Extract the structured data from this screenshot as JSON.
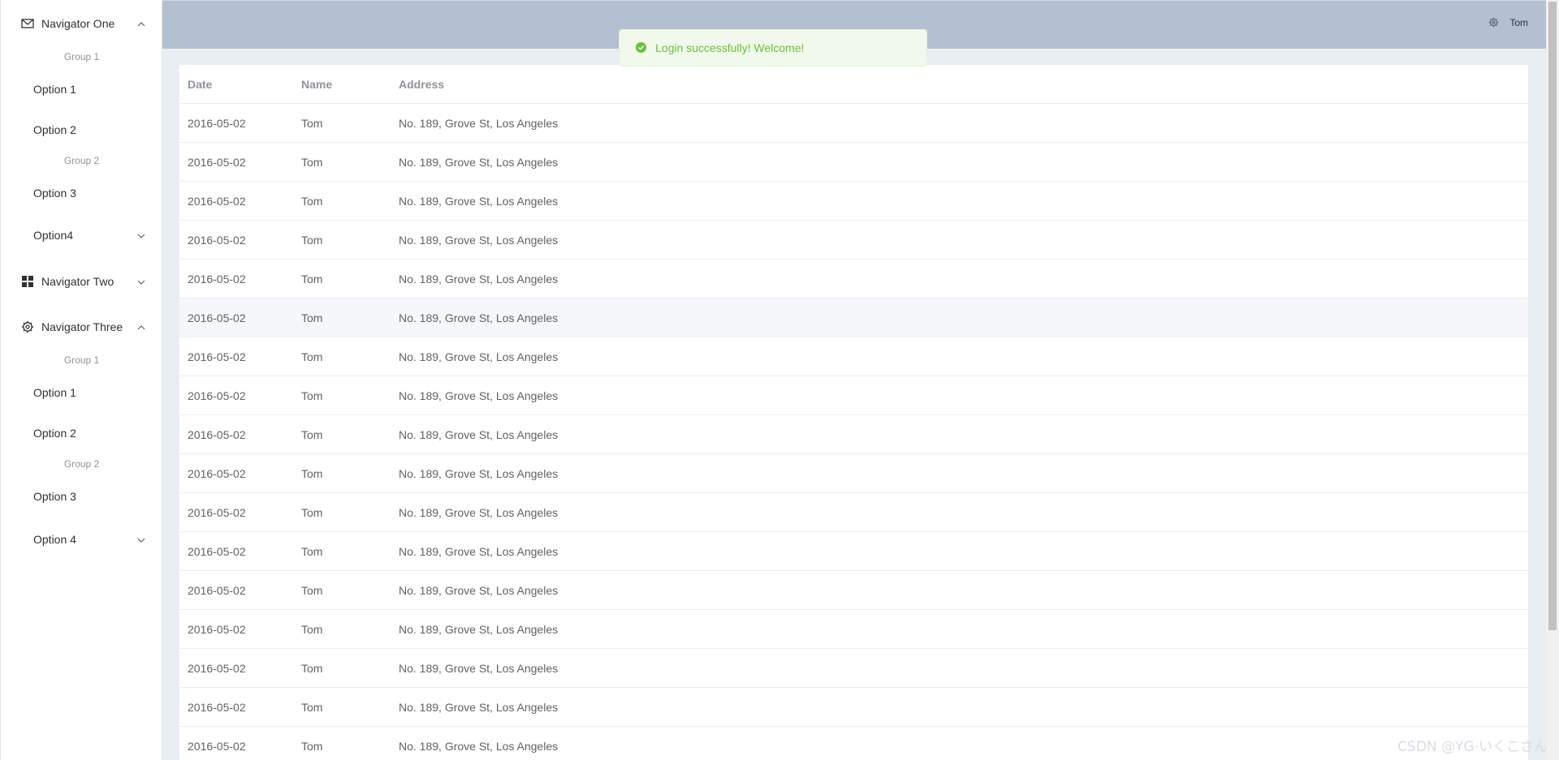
{
  "sidebar": {
    "nav1": {
      "label": "Navigator One",
      "icon": "mail-icon",
      "group1": "Group 1",
      "options1": [
        "Option 1",
        "Option 2"
      ],
      "group2": "Group 2",
      "options2": [
        "Option 3"
      ],
      "option4": "Option4"
    },
    "nav2": {
      "label": "Navigator Two",
      "icon": "grid-icon"
    },
    "nav3": {
      "label": "Navigator Three",
      "icon": "gear-icon",
      "group1": "Group 1",
      "options1": [
        "Option 1",
        "Option 2"
      ],
      "group2": "Group 2",
      "options2": [
        "Option 3"
      ],
      "option4": "Option 4"
    }
  },
  "header": {
    "user": "Tom",
    "settings_icon": "gear-icon"
  },
  "toast": {
    "message": "Login successfully! Welcome!",
    "icon": "check-circle-icon",
    "color": "#67c23a"
  },
  "table": {
    "columns": [
      "Date",
      "Name",
      "Address"
    ],
    "rows": [
      [
        "2016-05-02",
        "Tom",
        "No. 189, Grove St, Los Angeles"
      ],
      [
        "2016-05-02",
        "Tom",
        "No. 189, Grove St, Los Angeles"
      ],
      [
        "2016-05-02",
        "Tom",
        "No. 189, Grove St, Los Angeles"
      ],
      [
        "2016-05-02",
        "Tom",
        "No. 189, Grove St, Los Angeles"
      ],
      [
        "2016-05-02",
        "Tom",
        "No. 189, Grove St, Los Angeles"
      ],
      [
        "2016-05-02",
        "Tom",
        "No. 189, Grove St, Los Angeles"
      ],
      [
        "2016-05-02",
        "Tom",
        "No. 189, Grove St, Los Angeles"
      ],
      [
        "2016-05-02",
        "Tom",
        "No. 189, Grove St, Los Angeles"
      ],
      [
        "2016-05-02",
        "Tom",
        "No. 189, Grove St, Los Angeles"
      ],
      [
        "2016-05-02",
        "Tom",
        "No. 189, Grove St, Los Angeles"
      ],
      [
        "2016-05-02",
        "Tom",
        "No. 189, Grove St, Los Angeles"
      ],
      [
        "2016-05-02",
        "Tom",
        "No. 189, Grove St, Los Angeles"
      ],
      [
        "2016-05-02",
        "Tom",
        "No. 189, Grove St, Los Angeles"
      ],
      [
        "2016-05-02",
        "Tom",
        "No. 189, Grove St, Los Angeles"
      ],
      [
        "2016-05-02",
        "Tom",
        "No. 189, Grove St, Los Angeles"
      ],
      [
        "2016-05-02",
        "Tom",
        "No. 189, Grove St, Los Angeles"
      ],
      [
        "2016-05-02",
        "Tom",
        "No. 189, Grove St, Los Angeles"
      ]
    ],
    "hover_row_index": 5
  },
  "watermark": "CSDN @YG·いくこさん",
  "colors": {
    "header_bg": "#b3c0d1",
    "main_bg": "#e9eef3",
    "success": "#67c23a"
  }
}
